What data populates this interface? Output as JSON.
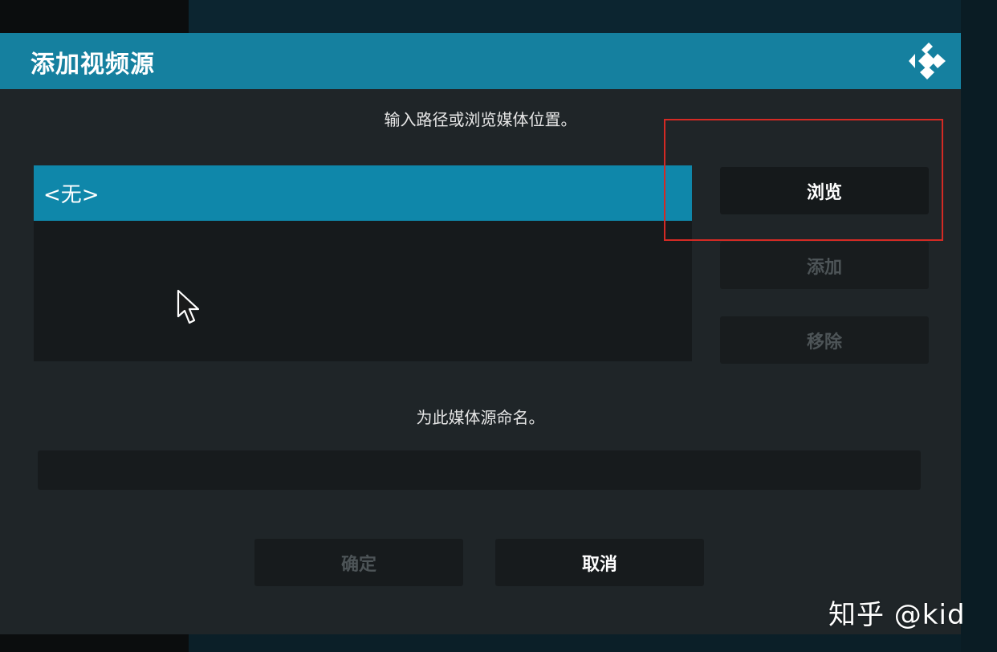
{
  "dialog": {
    "title": "添加视频源",
    "logo_icon": "kodi-logo-icon"
  },
  "path_section": {
    "hint": "输入路径或浏览媒体位置。",
    "items": [
      {
        "label": "<无>"
      }
    ]
  },
  "side_buttons": {
    "browse_label": "浏览",
    "add_label": "添加",
    "remove_label": "移除"
  },
  "name_section": {
    "hint": "为此媒体源命名。",
    "value": ""
  },
  "footer": {
    "ok_label": "确定",
    "cancel_label": "取消"
  },
  "watermark": "知乎 @kid",
  "colors": {
    "titlebar": "#15809f",
    "selected_item": "#0f87aa",
    "highlight_box": "#d42a24",
    "dialog_bg": "#1f2528"
  }
}
